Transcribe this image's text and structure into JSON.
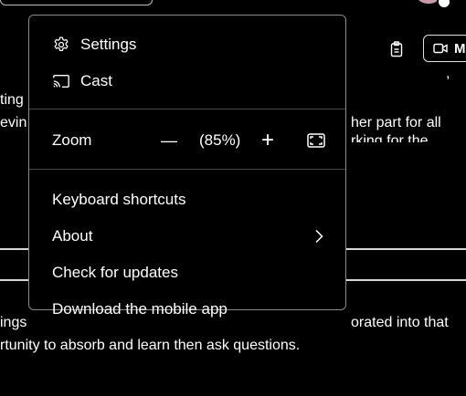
{
  "background": {
    "line1_left": "ting",
    "line2_left": "evin",
    "line2_right": "her part for all",
    "line3_right": "rking for the",
    "line4_left": "ings",
    "line4_right": "orated into that",
    "line5": "rtunity to absorb and learn then ask questions."
  },
  "toolbar": {
    "meet_label": "M"
  },
  "menu": {
    "settings_label": "Settings",
    "cast_label": "Cast",
    "zoom_label": "Zoom",
    "zoom_out_symbol": "—",
    "zoom_value": "(85%)",
    "zoom_in_symbol": "+",
    "keyboard_shortcuts_label": "Keyboard shortcuts",
    "about_label": "About",
    "check_updates_label": "Check for updates",
    "download_app_label": "Download the mobile app"
  },
  "icons": {
    "settings": "gear-icon",
    "cast": "cast-icon",
    "fullscreen": "fullscreen-icon",
    "about_chevron": "chevron-right-icon",
    "meet": "video-camera-icon",
    "clipboard": "clipboard-icon"
  },
  "colors": {
    "background": "#000000",
    "text": "#ffffff",
    "menu_border": "#8a8a8a",
    "separator": "#4a4a4a"
  }
}
